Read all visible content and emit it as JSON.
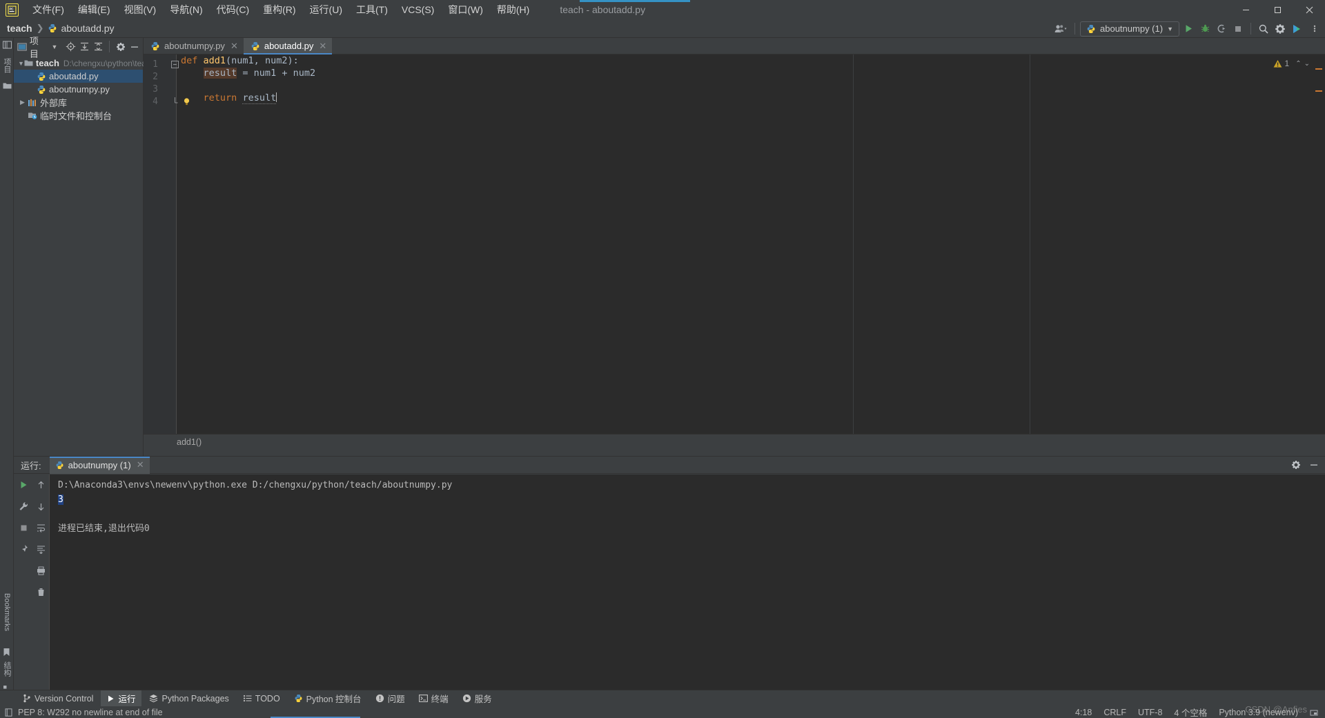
{
  "titlebar": {
    "logo": "PC",
    "window_title": "teach - aboutadd.py",
    "menu": [
      {
        "label": "文件(F)",
        "name": "menu-file"
      },
      {
        "label": "编辑(E)",
        "name": "menu-edit"
      },
      {
        "label": "视图(V)",
        "name": "menu-view"
      },
      {
        "label": "导航(N)",
        "name": "menu-navigate"
      },
      {
        "label": "代码(C)",
        "name": "menu-code"
      },
      {
        "label": "重构(R)",
        "name": "menu-refactor"
      },
      {
        "label": "运行(U)",
        "name": "menu-run"
      },
      {
        "label": "工具(T)",
        "name": "menu-tools"
      },
      {
        "label": "VCS(S)",
        "name": "menu-vcs"
      },
      {
        "label": "窗口(W)",
        "name": "menu-window"
      },
      {
        "label": "帮助(H)",
        "name": "menu-help"
      }
    ],
    "minimize": "—",
    "maximize": "❐",
    "close": "✕"
  },
  "navbar": {
    "breadcrumb_root": "teach",
    "breadcrumb_sep": "❯",
    "breadcrumb_file": "aboutadd.py",
    "run_config": "aboutnumpy (1)",
    "icons": {
      "user": "user-icon",
      "chevron": "▾",
      "run": "run-icon",
      "debug": "debug-icon",
      "coverage": "coverage-icon",
      "stop": "stop-icon",
      "search": "search-icon",
      "settings": "gear-icon",
      "updates": "updates-icon"
    }
  },
  "left_strip": {
    "top_labels": [
      "项目"
    ],
    "bottom_labels": [
      "Bookmarks",
      "结构"
    ]
  },
  "project_panel": {
    "title": "项目",
    "header_icons": [
      "chevron-down-icon",
      "locate-icon",
      "expand-all-icon",
      "collapse-all-icon",
      "gear-icon",
      "hide-icon"
    ],
    "tree": [
      {
        "label": "teach",
        "path": "D:\\chengxu\\python\\teach",
        "icon": "folder-icon",
        "expanded": true,
        "depth": 0,
        "bold": true,
        "selected": false
      },
      {
        "label": "aboutadd.py",
        "path": "",
        "icon": "python-file-icon",
        "expanded": null,
        "depth": 1,
        "bold": false,
        "selected": true
      },
      {
        "label": "aboutnumpy.py",
        "path": "",
        "icon": "python-file-icon",
        "expanded": null,
        "depth": 1,
        "bold": false,
        "selected": false
      },
      {
        "label": "外部库",
        "path": "",
        "icon": "library-icon",
        "expanded": false,
        "depth": 0,
        "bold": false,
        "selected": false
      },
      {
        "label": "临时文件和控制台",
        "path": "",
        "icon": "scratches-icon",
        "expanded": null,
        "depth": 0,
        "bold": false,
        "selected": false
      }
    ]
  },
  "editor": {
    "tabs": [
      {
        "label": "aboutnumpy.py",
        "icon": "python-file-icon",
        "active": false
      },
      {
        "label": "aboutadd.py",
        "icon": "python-file-icon",
        "active": true
      }
    ],
    "line_numbers": [
      "1",
      "2",
      "3",
      "4"
    ],
    "code_lines": [
      {
        "n": 1,
        "segments": [
          {
            "t": "def",
            "c": "kw"
          },
          {
            "t": " ",
            "c": "pl"
          },
          {
            "t": "add1",
            "c": "fn"
          },
          {
            "t": "(num1, num2):",
            "c": "pl"
          }
        ]
      },
      {
        "n": 2,
        "segments": [
          {
            "t": "    ",
            "c": "pl"
          },
          {
            "t": "result",
            "c": "hl"
          },
          {
            "t": " = num1 + num2",
            "c": "pl"
          }
        ]
      },
      {
        "n": 3,
        "segments": []
      },
      {
        "n": 4,
        "segments": [
          {
            "t": "    ",
            "c": "pl"
          },
          {
            "t": "return",
            "c": "kw"
          },
          {
            "t": " ",
            "c": "pl"
          },
          {
            "t": "result",
            "c": "usage"
          }
        ]
      }
    ],
    "inspection_count": "1",
    "inspection_icon": "warning-triangle-icon",
    "breadcrumb_bottom": "add1()"
  },
  "run_panel": {
    "label": "运行:",
    "tab": "aboutnumpy (1)",
    "tab_icon": "python-icon",
    "close_icon": "✕",
    "header_right_icons": [
      "gear-icon",
      "hide-icon"
    ],
    "tool_icons_col1": [
      "run-icon",
      "wrench-icon",
      "stop-icon",
      "pin-icon"
    ],
    "tool_icons_col2": [
      "up-arrow-icon",
      "down-arrow-icon",
      "soft-wrap-icon",
      "scroll-end-icon",
      "print-icon",
      "trash-icon"
    ],
    "console": {
      "command": "D:\\Anaconda3\\envs\\newenv\\python.exe D:/chengxu/python/teach/aboutnumpy.py",
      "output_selected": "3",
      "exit_message": "进程已结束,退出代码0"
    }
  },
  "toolwindow_bar": {
    "items": [
      {
        "label": "Version Control",
        "icon": "branch-icon",
        "active": false,
        "name": "tw-version-control"
      },
      {
        "label": "运行",
        "icon": "run-icon",
        "active": true,
        "name": "tw-run"
      },
      {
        "label": "Python Packages",
        "icon": "packages-icon",
        "active": false,
        "name": "tw-python-packages"
      },
      {
        "label": "TODO",
        "icon": "todo-icon",
        "active": false,
        "name": "tw-todo"
      },
      {
        "label": "Python 控制台",
        "icon": "python-icon",
        "active": false,
        "name": "tw-python-console"
      },
      {
        "label": "问题",
        "icon": "problems-icon",
        "active": false,
        "name": "tw-problems"
      },
      {
        "label": "终端",
        "icon": "terminal-icon",
        "active": false,
        "name": "tw-terminal"
      },
      {
        "label": "服务",
        "icon": "services-icon",
        "active": false,
        "name": "tw-services"
      }
    ]
  },
  "statusbar": {
    "message": "PEP 8: W292 no newline at end of file",
    "message_icon": "inspection-icon",
    "caret_position": "4:18",
    "line_separator": "CRLF",
    "encoding": "UTF-8",
    "indent": "4 个空格",
    "interpreter": "Python 3.9 (newenv)",
    "watermark": "CSDN @Anfies"
  },
  "colors": {
    "accent": "#4a88c7",
    "selection": "#2d4f70",
    "console_selection": "#214283",
    "keyword": "#cc7832",
    "function": "#ffc66d",
    "plain": "#a9b7c6",
    "highlight": "#543a2b",
    "chrome": "#3c3f41",
    "editor_bg": "#2b2b2b"
  }
}
